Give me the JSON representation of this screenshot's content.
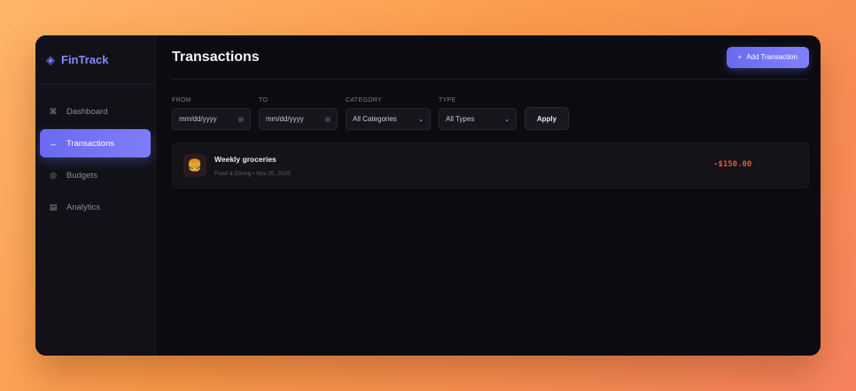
{
  "brand": {
    "name": "FinTrack",
    "icon": "diamond-icon"
  },
  "sidebar": {
    "items": [
      {
        "label": "Dashboard",
        "icon": "command-icon",
        "glyph": "⌘",
        "active": false
      },
      {
        "label": "Transactions",
        "icon": "swap-arrows-icon",
        "glyph": "↔",
        "active": true
      },
      {
        "label": "Budgets",
        "icon": "target-icon",
        "glyph": "◎",
        "active": false
      },
      {
        "label": "Analytics",
        "icon": "chart-box-icon",
        "glyph": "▤",
        "active": false
      }
    ]
  },
  "header": {
    "title": "Transactions",
    "add_button": {
      "icon": "+",
      "label": "Add Transaction"
    }
  },
  "filters": {
    "from": {
      "label": "FROM",
      "value": "mm/dd/yyyy"
    },
    "to": {
      "label": "TO",
      "value": "mm/dd/yyyy"
    },
    "category": {
      "label": "CATEGORY",
      "value": "All Categories"
    },
    "type": {
      "label": "TYPE",
      "value": "All Types"
    },
    "apply_label": "Apply"
  },
  "transactions": [
    {
      "title": "Weekly groceries",
      "meta": "Food & Dining • Nov 25, 2025",
      "amount": "-$150.00",
      "icon": "burger-icon",
      "glyph": "🍔"
    }
  ],
  "colors": {
    "accent": "#7070f5",
    "negative_amount": "#e0564d",
    "background": "#0b0b10"
  }
}
